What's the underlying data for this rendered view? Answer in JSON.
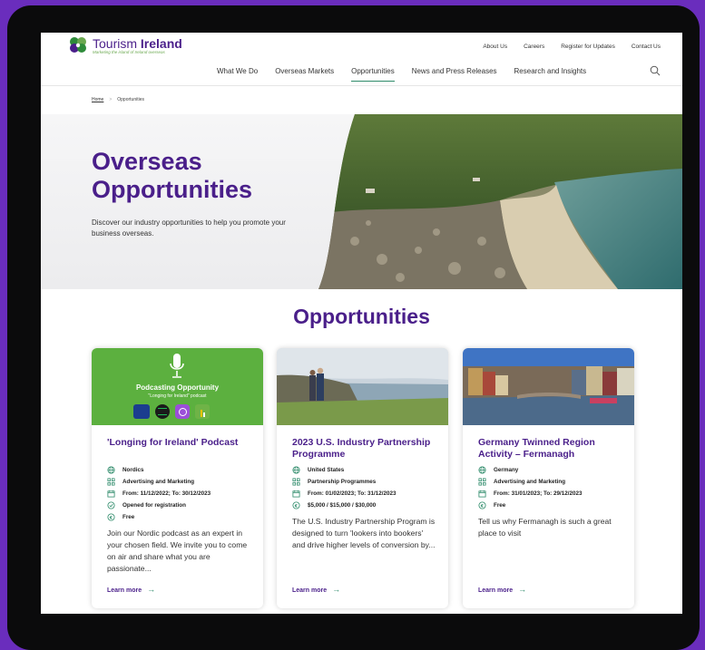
{
  "brand": {
    "name_light": "Tourism ",
    "name_bold": "Ireland",
    "tagline": "Marketing the island of Ireland overseas"
  },
  "top_links": [
    "About Us",
    "Careers",
    "Register for Updates",
    "Contact Us"
  ],
  "nav": [
    "What We Do",
    "Overseas Markets",
    "Opportunities",
    "News and Press Releases",
    "Research and Insights"
  ],
  "nav_active": "Opportunities",
  "breadcrumb": {
    "home": "Home",
    "separator": ">",
    "current": "Opportunities"
  },
  "hero": {
    "title_line1": "Overseas",
    "title_line2": "Opportunities",
    "description": "Discover our industry opportunities to help you promote your business overseas."
  },
  "section_title": "Opportunities",
  "cards": [
    {
      "image_title": "Podcasting Opportunity",
      "image_subtitle": "\"Longing for Ireland\" podcast",
      "title": "'Longing for Ireland' Podcast",
      "meta": {
        "market": "Nordics",
        "category": "Advertising and Marketing",
        "dates": "From: 11/12/2022; To: 30/12/2023",
        "status": "Opened for registration",
        "cost": "Free"
      },
      "description": "Join our Nordic podcast as an expert in your chosen field. We invite you to come on air and share what you are passionate...",
      "learn_more": "Learn more"
    },
    {
      "title": "2023 U.S. Industry Partnership Programme",
      "meta": {
        "market": "United States",
        "category": "Partnership Programmes",
        "dates": "From: 01/02/2023; To: 31/12/2023",
        "cost": "$5,000 / $15,000 / $30,000"
      },
      "description": "The U.S. Industry Partnership Program is designed to turn 'lookers into bookers' and drive higher levels of conversion by...",
      "learn_more": "Learn more"
    },
    {
      "title": "Germany Twinned Region Activity – Fermanagh",
      "meta": {
        "market": "Germany",
        "category": "Advertising and Marketing",
        "dates": "From: 31/01/2023; To: 29/12/2023",
        "cost": "Free"
      },
      "description": "Tell us why Fermanagh is such a great place to visit",
      "learn_more": "Learn more"
    }
  ],
  "colors": {
    "brand_purple": "#4a1f8a",
    "accent_green": "#2e8b6a",
    "podcast_green": "#5cb03f",
    "background_purple": "#6a2dbd"
  }
}
